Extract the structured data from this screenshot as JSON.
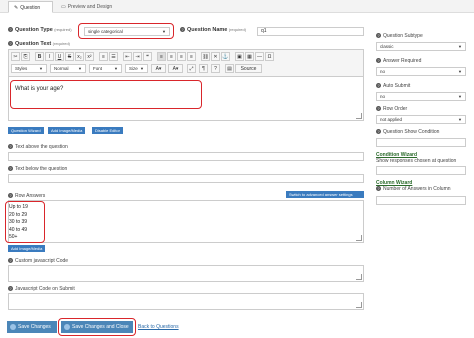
{
  "tabs": [
    {
      "label": "Question",
      "icon": "pencil-icon"
    },
    {
      "label": "Preview and Design",
      "icon": "monitor-icon"
    }
  ],
  "question_type": {
    "label": "Question Type",
    "required": "(required)",
    "value": "single categorical"
  },
  "question_name": {
    "label": "Question Name",
    "required": "(required)",
    "value": "q1"
  },
  "question_text": {
    "label": "Question Text",
    "required": "(required)",
    "value": "What is your age?"
  },
  "toolbar": {
    "styles": "Styles",
    "format": "Normal",
    "font": "Font",
    "size": "Size",
    "source": "Source"
  },
  "editor_buttons": [
    "Question Wizard",
    "Add Image/Media",
    "Disable Editor"
  ],
  "text_above": {
    "label": "Text above the question"
  },
  "text_below": {
    "label": "Text below the question"
  },
  "row_answers": {
    "label": "Row Answers",
    "switch_label": "Switch to advanced answer settings",
    "items": [
      "Up to 19",
      "20 to 29",
      "30 to 39",
      "40 to 49",
      "50+"
    ],
    "add_media": "Add Image/Media"
  },
  "custom_js": {
    "label": "Custom javascript Code"
  },
  "js_on_submit": {
    "label": "Javascript Code on Submit"
  },
  "footer": {
    "save_changes": "Save Changes",
    "save_close": "Save Changes and Close",
    "back": "Back to Questions"
  },
  "sidebar": {
    "question_subtype": {
      "label": "Question Subtype",
      "value": "classic"
    },
    "answer_required": {
      "label": "Answer Required",
      "value": "no"
    },
    "auto_submit": {
      "label": "Auto Submit",
      "value": "no"
    },
    "row_order": {
      "label": "Row Order",
      "value": "not applied"
    },
    "show_condition": {
      "label": "Question Show Condition"
    },
    "condition_wizard": {
      "label": "Condition Wizard",
      "sub": "Show responses chosen at question"
    },
    "column_wizard": {
      "label": "Column Wizard"
    },
    "num_answers": {
      "label": "Number of Answers in Column"
    }
  },
  "colors": {
    "accent": "#3a7bbf",
    "highlight": "#d9262b",
    "link": "#2a6a2a"
  }
}
